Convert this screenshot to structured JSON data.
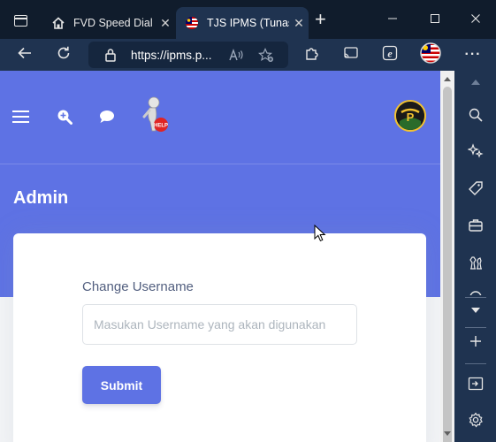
{
  "browser": {
    "tabs": [
      {
        "title": "FVD Speed Dial",
        "favicon": "house-icon",
        "active": false
      },
      {
        "title": "TJS IPMS (Tunas",
        "favicon": "malaysia-flag-icon",
        "active": true
      }
    ],
    "new_tab_symbol": "+",
    "close_symbol": "✕",
    "address": "https://ipms.p...",
    "toolbar_icons": [
      "back-icon",
      "refresh-icon",
      "lock-icon",
      "read-aloud-icon",
      "add-favorite-icon",
      "extensions-icon",
      "cast-icon",
      "ie-mode-icon",
      "profile-icon",
      "more-icon"
    ],
    "more_symbol": "···",
    "colors": {
      "titlebar": "#101c2c",
      "toolbar": "#1f3350"
    }
  },
  "sidebar_icons": [
    "scroll-up-icon",
    "search-icon",
    "copilot-icon",
    "tag-icon",
    "briefcase-icon",
    "chess-icon",
    "more-tools-icon",
    "add-icon",
    "split-screen-icon",
    "settings-icon"
  ],
  "navbar": {
    "icons": [
      "menu-icon",
      "zoom-icon",
      "chat-icon",
      "mascot-icon"
    ],
    "brand": "IPMS logo"
  },
  "page": {
    "title": "Admin",
    "form": {
      "label": "Change Username",
      "placeholder": "Masukan Username yang akan digunakan",
      "value": "",
      "submit_label": "Submit"
    },
    "colors": {
      "primary": "#5e72e4",
      "background": "#f4f5f7",
      "text": "#525f7f"
    }
  }
}
